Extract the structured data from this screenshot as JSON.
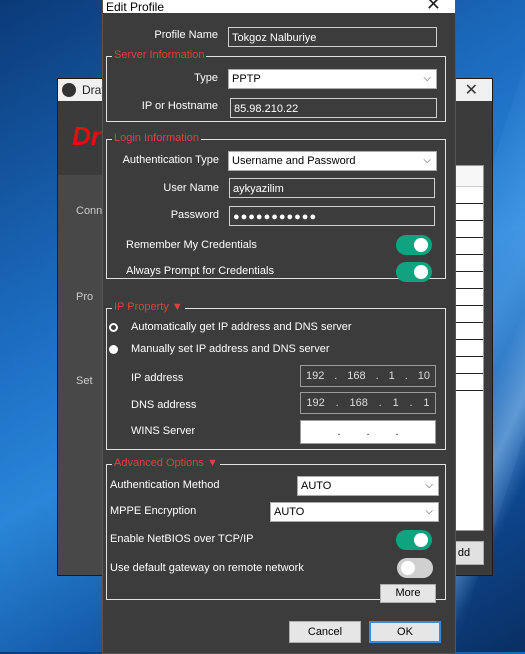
{
  "background_app": {
    "title": "Dray",
    "brand": "Dr",
    "side_items": [
      "Conn",
      "Pro",
      "Set"
    ],
    "add_button": "dd"
  },
  "dialog": {
    "title": "Edit Profile",
    "profile_name_label": "Profile Name",
    "profile_name_value": "Tokgoz Nalburiye",
    "server": {
      "legend": "Server Information",
      "type_label": "Type",
      "type_value": "PPTP",
      "host_label": "IP or Hostname",
      "host_value": "85.98.210.22"
    },
    "login": {
      "legend": "Login Information",
      "auth_label": "Authentication Type",
      "auth_value": "Username and Password",
      "user_label": "User Name",
      "user_value": "aykyazilim",
      "password_label": "Password",
      "password_value": "●●●●●●●●●●●",
      "remember_label": "Remember My Credentials",
      "remember_on": true,
      "prompt_label": "Always Prompt for Credentials",
      "prompt_on": true
    },
    "ip": {
      "legend": "IP Property ▼",
      "auto_label": "Automatically get IP address and DNS server",
      "manual_label": "Manually set IP address and DNS server",
      "selected": "auto",
      "ip_label": "IP address",
      "ip_parts": [
        "192",
        ".",
        "168",
        ".",
        "1",
        ".",
        "10"
      ],
      "dns_label": "DNS address",
      "dns_parts": [
        "192",
        ".",
        "168",
        ".",
        "1",
        ".",
        "1"
      ],
      "wins_label": "WINS Server",
      "wins_parts": [
        ".",
        ".",
        "."
      ]
    },
    "advanced": {
      "legend": "Advanced Options ▼",
      "auth_method_label": "Authentication Method",
      "auth_method_value": "AUTO",
      "mppe_label": "MPPE Encryption",
      "mppe_value": "AUTO",
      "netbios_label": "Enable NetBIOS over TCP/IP",
      "netbios_on": true,
      "gateway_label": "Use default gateway on remote network",
      "gateway_on": false,
      "more_button": "More"
    },
    "cancel_button": "Cancel",
    "ok_button": "OK"
  },
  "colors": {
    "dialog_bg": "#3c3c3c",
    "legend_red": "#e04040",
    "toggle_on": "#11a37f",
    "ok_border": "#3c8ad8"
  }
}
